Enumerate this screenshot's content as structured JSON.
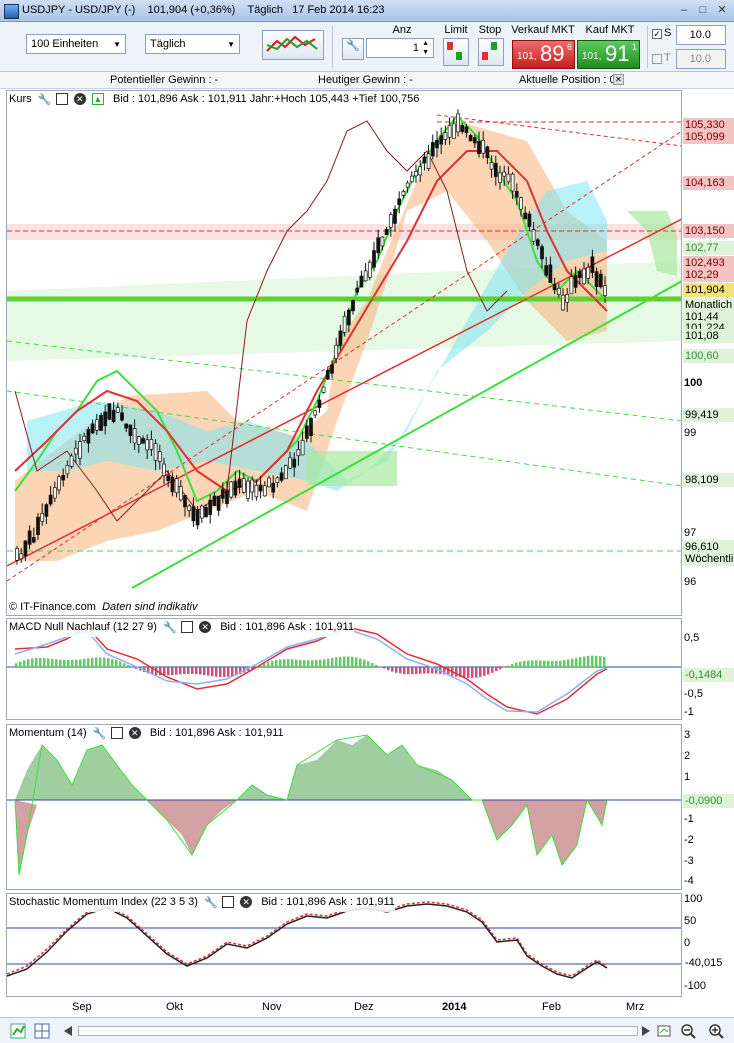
{
  "window": {
    "title": "USDJPY - USD/JPY (-)",
    "last_price": "101,904",
    "change": "(+0,36%)",
    "period": "Täglich",
    "datetime": "17 Feb 2014 16:23"
  },
  "toolbar": {
    "units_select": "100 Einheiten",
    "period_select": "Täglich",
    "qty_label": "Anz",
    "qty_value": "1",
    "limit_label": "Limit",
    "stop_label": "Stop",
    "sell_label": "Verkauf MKT",
    "sell_price_small": "101,",
    "sell_price_big": "89",
    "sell_price_sup": "6",
    "buy_label": "Kauf MKT",
    "buy_price_small": "101,",
    "buy_price_big": "91",
    "buy_price_sup": "1",
    "s_label": "S",
    "s_value": "10.0",
    "t_label": "T",
    "t_value": "10.0"
  },
  "infobar": {
    "potential_gain": "Potentieller Gewinn : -",
    "today_gain": "Heutiger Gewinn : -",
    "current_position": "Aktuelle Position : 0"
  },
  "panes": {
    "price": {
      "name": "Kurs",
      "info": "Bid : 101,896  Ask : 101,911  Jahr:+Hoch 105,443  +Tief 100,756",
      "copyright": "© IT-Finance.com",
      "disclaimer": "Daten sind indikativ",
      "axis_ticks": [
        "100",
        "99",
        "97",
        "96"
      ],
      "tags": [
        {
          "text": "105,330",
          "bg": "#f4c3c3",
          "fg": "#7a0000"
        },
        {
          "text": "105,099",
          "bg": "#f4c3c3",
          "fg": "#7a0000"
        },
        {
          "text": "104,163",
          "bg": "#f4c3c3",
          "fg": "#7a0000"
        },
        {
          "text": "103,150",
          "bg": "#f4c3c3",
          "fg": "#7a0000"
        },
        {
          "text": "102,77",
          "bg": "#dff3d9",
          "fg": "#2f8f2f"
        },
        {
          "text": "102,493",
          "bg": "#f4c3c3",
          "fg": "#7a0000"
        },
        {
          "text": "102,29",
          "bg": "#f4c3c3",
          "fg": "#7a0000"
        },
        {
          "text": "101,904",
          "bg": "#f5e27a",
          "fg": "#000000"
        },
        {
          "text": "Monatlich",
          "bg": "#dff3d9",
          "fg": "#000000"
        },
        {
          "text": "101,44",
          "bg": "#dff3d9",
          "fg": "#000000"
        },
        {
          "text": "101,224",
          "bg": "#dff3d9",
          "fg": "#000000"
        },
        {
          "text": "101,08",
          "bg": "#dff3d9",
          "fg": "#000000"
        },
        {
          "text": "100,60",
          "bg": "#dff3d9",
          "fg": "#2f8f2f"
        },
        {
          "text": "99,419",
          "bg": "#dff3d9",
          "fg": "#000000"
        },
        {
          "text": "98,109",
          "bg": "#dff3d9",
          "fg": "#000000"
        },
        {
          "text": "96,610",
          "bg": "#dff3d9",
          "fg": "#000000"
        },
        {
          "text": "Wöchentli",
          "bg": "#dff3d9",
          "fg": "#000000"
        }
      ]
    },
    "macd": {
      "name": "MACD Null Nachlauf (12 27 9)",
      "info": "Bid : 101,896  Ask : 101,911",
      "axis_ticks": [
        "0,5",
        "-0,5",
        "-1"
      ],
      "tag": "-0,1484"
    },
    "momentum": {
      "name": "Momentum (14)",
      "info": "Bid : 101,896  Ask : 101,911",
      "axis_ticks": [
        "3",
        "2",
        "1",
        "-1",
        "-2",
        "-3",
        "-4"
      ],
      "tag": "-0,0900"
    },
    "smi": {
      "name": "Stochastic Momentum Index (22 3 5 3)",
      "info": "Bid : 101,896  Ask : 101,911",
      "axis_ticks": [
        "100",
        "50",
        "0",
        "-100"
      ],
      "tag": "-40,015"
    }
  },
  "xaxis": {
    "labels": [
      "Sep",
      "Okt",
      "Nov",
      "Dez",
      "2014",
      "Feb",
      "Mrz"
    ]
  },
  "colors": {
    "bull": "#5ad15a",
    "bear": "#e03030",
    "cloud_green": "#a8e8a0",
    "cloud_blue": "#7ee6f0",
    "cloud_orange": "#f7b27a"
  }
}
